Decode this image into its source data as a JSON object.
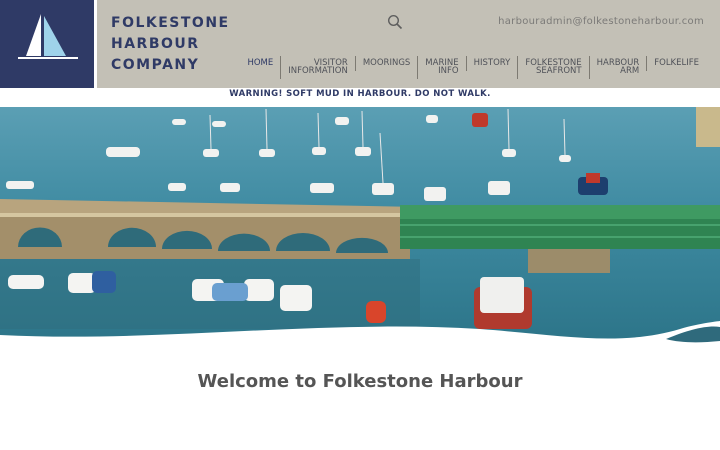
{
  "brand": {
    "line1": "FOLKESTONE",
    "line2": "HARBOUR",
    "line3": "COMPANY"
  },
  "header": {
    "email": "harbouradmin@folkestoneharbour.com",
    "search_icon": "search-icon"
  },
  "nav": {
    "items": [
      {
        "label": "HOME"
      },
      {
        "label": "VISITOR\nINFORMATION"
      },
      {
        "label": "MOORINGS"
      },
      {
        "label": "MARINE\nINFO"
      },
      {
        "label": "HISTORY"
      },
      {
        "label": "FOLKESTONE\nSEAFRONT"
      },
      {
        "label": "HARBOUR\nARM"
      },
      {
        "label": "FOLKELIFE"
      }
    ]
  },
  "warning": {
    "text": "WARNING! SOFT MUD IN HARBOUR. DO NOT WALK."
  },
  "hero": {
    "image": "harbour-photo"
  },
  "main": {
    "welcome": "Welcome to Folkestone Harbour"
  },
  "colors": {
    "navy": "#2f3a66",
    "header_bg": "#c3c0b6",
    "water": "#3f8aa0"
  }
}
